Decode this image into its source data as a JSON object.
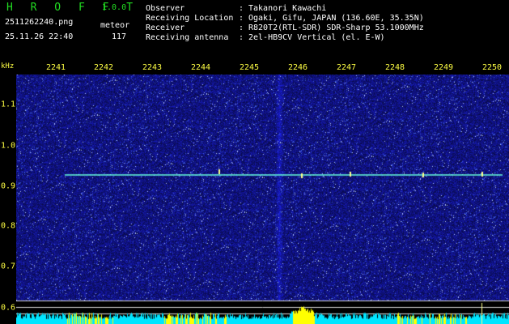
{
  "header": {
    "app_title": "H R O F F T",
    "app_version": "1.0.0",
    "filename": "2511262240.png",
    "datetime": "25.11.26 22:40",
    "mode_label": "meteor",
    "count": "117",
    "info": [
      {
        "label": "Observer",
        "value": "Takanori Kawachi"
      },
      {
        "label": "Receiving Location",
        "value": "Ogaki, Gifu, JAPAN (136.60E, 35.35N)"
      },
      {
        "label": "Receiver",
        "value": "R820T2(RTL-SDR) SDR-Sharp 53.1000MHz"
      },
      {
        "label": "Receiving antenna",
        "value": "2el-HB9CV Vertical (el. E-W)"
      }
    ],
    "separator": ":"
  },
  "freq_axis": {
    "labels": [
      "2241",
      "2242",
      "2243",
      "2244",
      "2245",
      "2246",
      "2247",
      "2248",
      "2249",
      "2250"
    ]
  },
  "y_axis": {
    "unit": "kHz",
    "labels": [
      "1.1",
      "1.0",
      "0.9",
      "0.8",
      "0.7",
      "0.6"
    ]
  },
  "colors": {
    "background": "#000000",
    "axis_text": "#ffff44",
    "title_green": "#22dd22",
    "noise_blue": "#1a1aa0",
    "carrier_cyan": "#66ffdd",
    "spectrum_cyan": "#00e5ff",
    "spectrum_yellow": "#ffff00"
  }
}
